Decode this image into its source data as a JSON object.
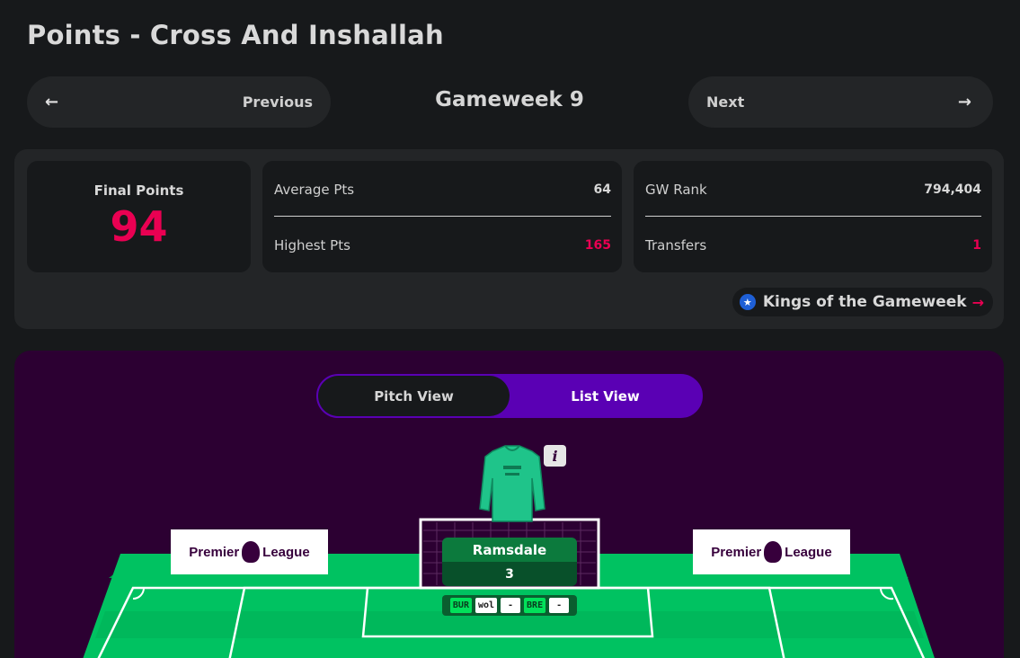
{
  "page": {
    "title": "Points - Cross And Inshallah"
  },
  "navigation": {
    "previous_label": "Previous",
    "previous_arrow": "←",
    "next_label": "Next",
    "next_arrow": "→",
    "gameweek_title": "Gameweek 9"
  },
  "summary": {
    "final_points_label": "Final Points",
    "final_points_value": "94",
    "average_label": "Average Pts",
    "average_value": "64",
    "highest_label": "Highest Pts",
    "highest_value": "165",
    "gw_rank_label": "GW Rank",
    "gw_rank_value": "794,404",
    "transfers_label": "Transfers",
    "transfers_value": "1",
    "kings_link_label": "Kings of the Gameweek",
    "kings_icon": "star-badge-icon",
    "kings_arrow": "→"
  },
  "pitch": {
    "toggle": {
      "pitch_view_label": "Pitch View",
      "list_view_label": "List View",
      "active": "Pitch View"
    },
    "sponsor_left": {
      "word1": "Premier",
      "word2": "League"
    },
    "sponsor_right": {
      "word1": "Premier",
      "word2": "League"
    },
    "info_button": "i",
    "player": {
      "name": "Ramsdale",
      "points": "3",
      "shirt_icon": "goalkeeper-shirt-icon",
      "fixtures": [
        {
          "text": "BUR",
          "style": "green"
        },
        {
          "text": "wol",
          "style": "white"
        },
        {
          "text": "-",
          "style": "white"
        },
        {
          "text": "BRE",
          "style": "green"
        },
        {
          "text": "-",
          "style": "white"
        }
      ]
    }
  },
  "colors": {
    "accent_pink": "#e90052",
    "toggle_purple": "#5a00b4",
    "panel_purple": "#2c0032",
    "pitch_green": "#00c261"
  }
}
